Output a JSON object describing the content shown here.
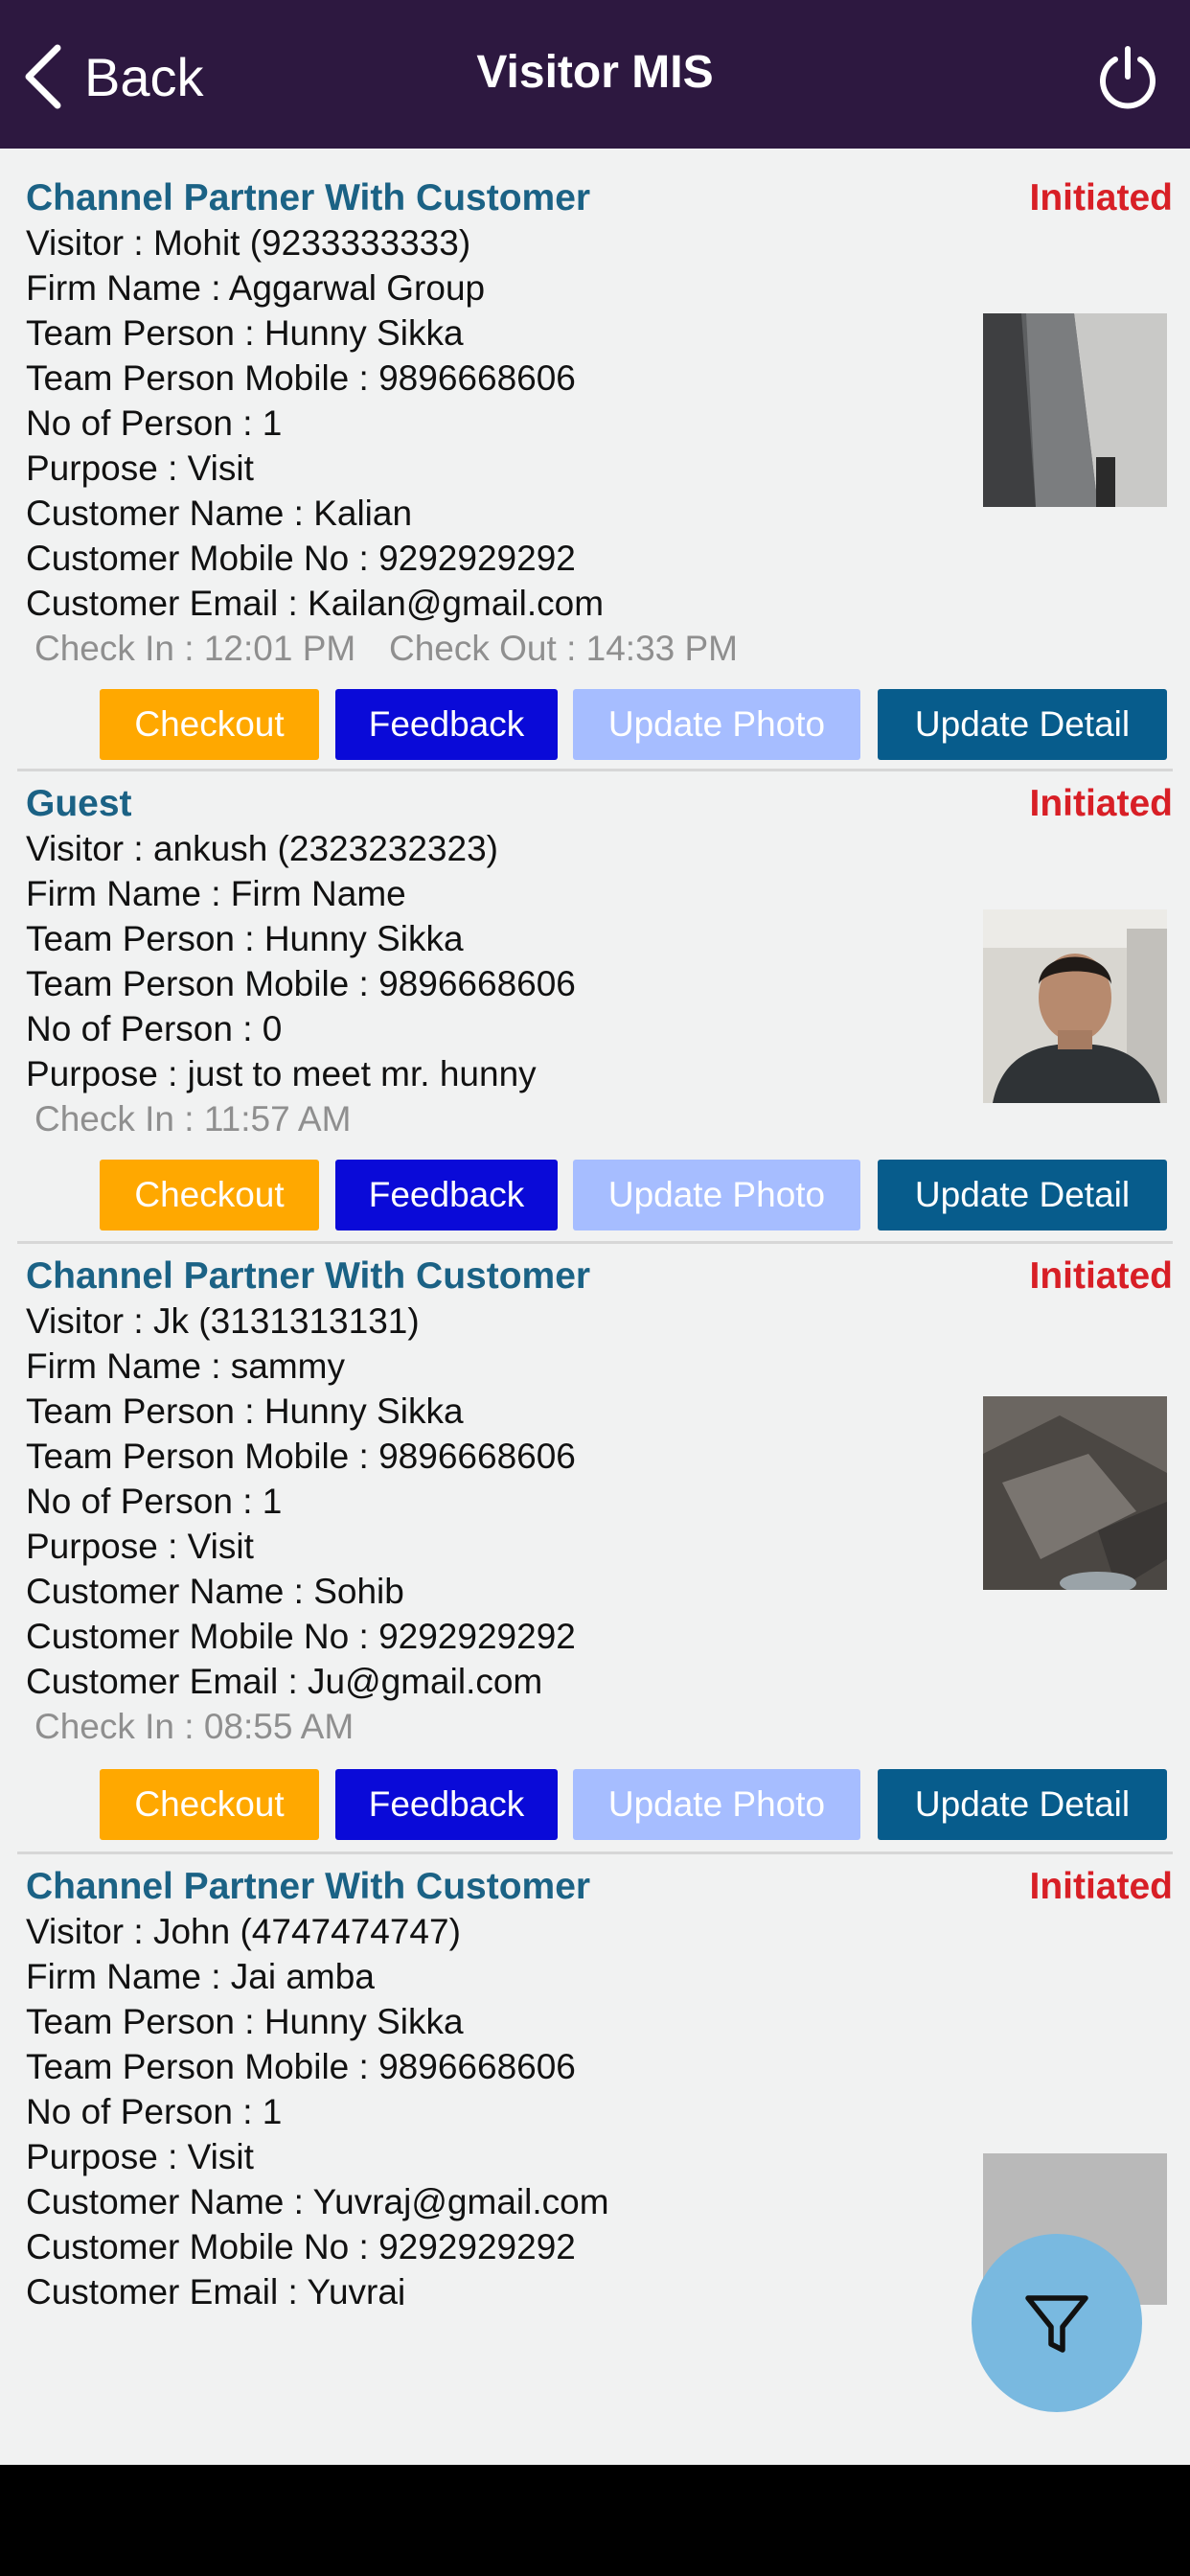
{
  "header": {
    "back_label": "Back",
    "title": "Visitor MIS"
  },
  "buttons": {
    "checkout": "Checkout",
    "feedback": "Feedback",
    "update_photo": "Update Photo",
    "update_detail": "Update Detail"
  },
  "cards": [
    {
      "type": "Channel Partner With Customer",
      "status": "Initiated",
      "lines": [
        "Visitor : Mohit (9233333333)",
        "Firm Name : Aggarwal  Group",
        "Team Person : Hunny Sikka",
        "Team Person Mobile : 9896668606",
        "No of Person : 1",
        "Purpose : Visit",
        "Customer Name : Kalian",
        "Customer Mobile No : 9292929292",
        "Customer Email : Kailan@gmail.com"
      ],
      "checkin": "Check In : 12:01 PM",
      "checkout": "Check Out : 14:33 PM"
    },
    {
      "type": "Guest",
      "status": "Initiated",
      "lines": [
        "Visitor : ankush (2323232323)",
        "Firm Name : Firm Name",
        "Team Person : Hunny Sikka",
        "Team Person Mobile : 9896668606",
        "No of Person : 0",
        "Purpose : just to meet mr. hunny"
      ],
      "checkin": "Check In : 11:57 AM"
    },
    {
      "type": "Channel Partner With Customer",
      "status": "Initiated",
      "lines": [
        "Visitor : Jk (3131313131)",
        "Firm Name : sammy",
        "Team Person : Hunny Sikka",
        "Team Person Mobile : 9896668606",
        "No of Person : 1",
        "Purpose : Visit",
        "Customer Name : Sohib",
        "Customer Mobile No : 9292929292",
        "Customer Email : Ju@gmail.com"
      ],
      "checkin": "Check In : 08:55 AM"
    },
    {
      "type": "Channel Partner With Customer",
      "status": "Initiated",
      "lines": [
        "Visitor : John (4747474747)",
        "Firm Name : Jai amba",
        "Team Person : Hunny Sikka",
        "Team Person Mobile : 9896668606",
        "No of Person : 1",
        "Purpose : Visit",
        "Customer Name : Yuvraj@gmail.com",
        "Customer Mobile No : 9292929292",
        "Customer Email : Yuvraj"
      ]
    }
  ],
  "icons": {
    "back": "chevron-left-icon",
    "power": "power-icon",
    "filter": "filter-icon"
  },
  "colors": {
    "header_bg": "#2d1840",
    "type_text": "#1b6285",
    "status_text": "#d81f26",
    "checkout_btn": "#ffa800",
    "feedback_btn": "#0a0ad8",
    "update_photo_btn": "#a6bdff",
    "update_detail_btn": "#075c8c",
    "fab_bg": "#79b9e0"
  }
}
